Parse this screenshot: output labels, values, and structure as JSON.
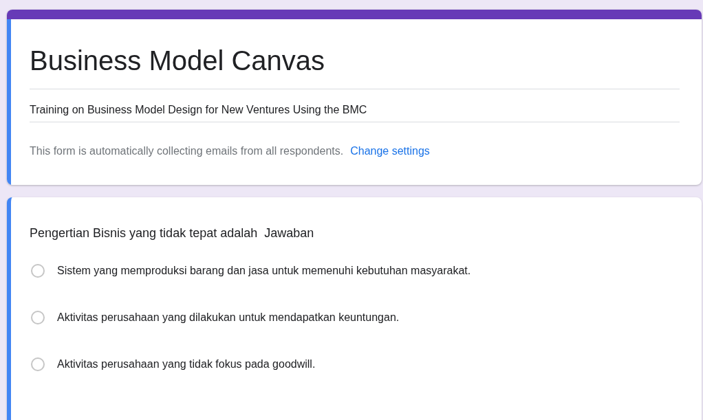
{
  "form": {
    "title": "Business Model Canvas",
    "description": "Training on Business Model Design for New Ventures Using the BMC",
    "email_notice": "This form is automatically collecting emails from all respondents.",
    "settings_link": "Change settings"
  },
  "question": {
    "text": "Pengertian Bisnis yang tidak tepat adalah  Jawaban",
    "options": [
      {
        "label": "Sistem yang memproduksi barang dan jasa untuk memenuhi kebutuhan masyarakat.",
        "selected": false
      },
      {
        "label": "Aktivitas perusahaan yang dilakukan untuk mendapatkan keuntungan.",
        "selected": false
      },
      {
        "label": "Aktivitas perusahaan yang tidak fokus pada goodwill.",
        "selected": false
      }
    ]
  }
}
